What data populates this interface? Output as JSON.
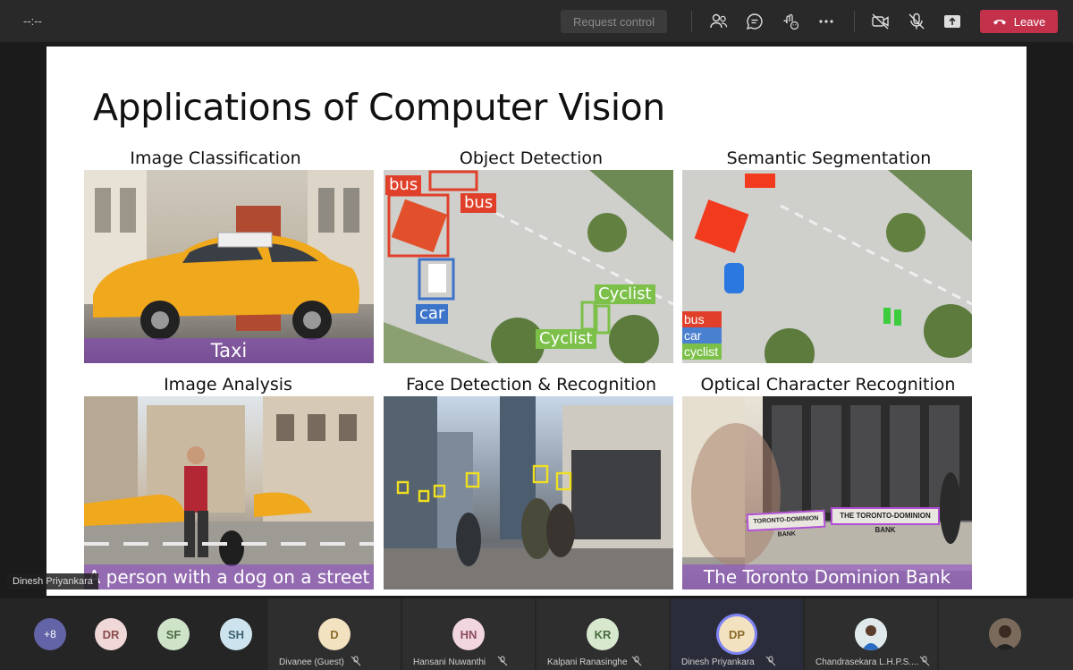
{
  "topbar": {
    "timer": "--:--",
    "request_control_label": "Request control",
    "leave_label": "Leave",
    "icons": [
      "participants-icon",
      "chat-icon",
      "reactions-icon",
      "more-icon",
      "camera-off-icon",
      "mic-off-icon",
      "share-icon"
    ]
  },
  "slide": {
    "title": "Applications of Computer Vision",
    "panels": [
      {
        "caption": "Image Classification",
        "banner": "Taxi"
      },
      {
        "caption": "Object Detection",
        "labels": [
          "bus",
          "bus",
          "car",
          "Cyclist",
          "Cyclist"
        ]
      },
      {
        "caption": "Semantic Segmentation",
        "legend": [
          "bus",
          "car",
          "cyclist"
        ]
      },
      {
        "caption": "Image Analysis",
        "banner": "A person with a dog on a street"
      },
      {
        "caption": "Face Detection & Recognition"
      },
      {
        "caption": "Optical Character Recognition",
        "banner": "The Toronto Dominion Bank",
        "signs": [
          "TORONTO-DOMINION BANK",
          "THE TORONTO-DOMINION BANK"
        ]
      }
    ]
  },
  "speaker_tag": "Dinesh Priyankara",
  "roster": {
    "overflow": "+8",
    "small_avatars": [
      {
        "initials": "DR",
        "color": "#f0d8d8"
      },
      {
        "initials": "SF",
        "color": "#cfe3c9"
      },
      {
        "initials": "SH",
        "color": "#cde4ee"
      }
    ],
    "participants": [
      {
        "initials": "D",
        "name": "Divanee (Guest)",
        "color": "#f3e2bf"
      },
      {
        "initials": "HN",
        "name": "Hansani Nuwanthi",
        "color": "#f2d6df"
      },
      {
        "initials": "KR",
        "name": "Kalpani Ranasinghe",
        "color": "#d7e8cf"
      },
      {
        "initials": "DP",
        "name": "Dinesh Priyankara",
        "color": "#f3e2bf"
      },
      {
        "initials": "",
        "name": "Chandrasekara L.H.P.S....",
        "color": "#eeeeee"
      }
    ]
  },
  "colors": {
    "accent": "#6264a7",
    "leave": "#c4314b"
  }
}
